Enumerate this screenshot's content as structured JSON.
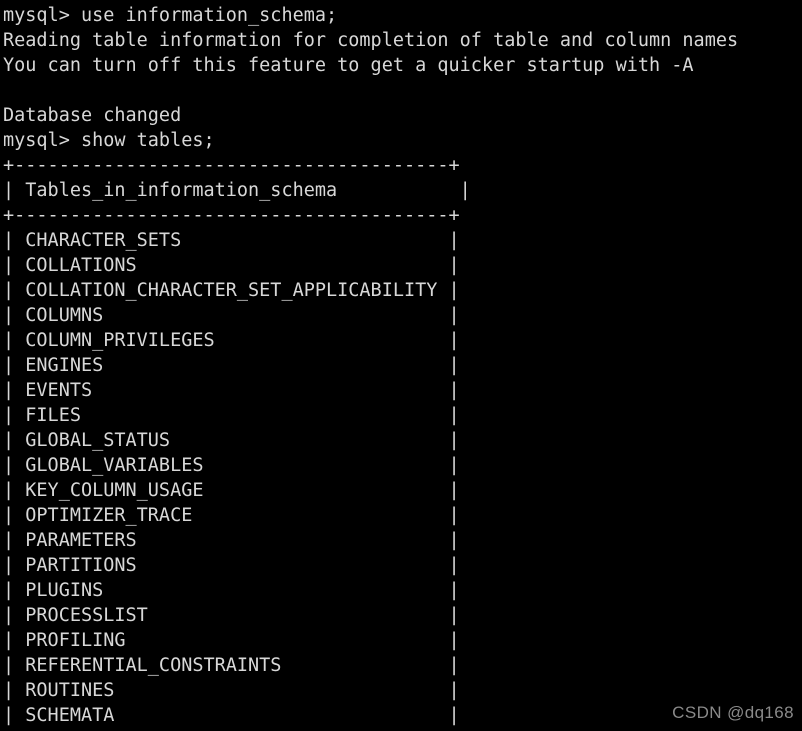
{
  "terminal": {
    "background_color": "#000000",
    "text_color": "#d8d8d8",
    "prompt": "mysql>",
    "lines": [
      "mysql> use information_schema;",
      "Reading table information for completion of table and column names",
      "You can turn off this feature to get a quicker startup with -A",
      "",
      "Database changed",
      "mysql> show tables;",
      "+---------------------------------------+",
      "| Tables_in_information_schema           |",
      "+---------------------------------------+",
      "| CHARACTER_SETS                        |",
      "| COLLATIONS                            |",
      "| COLLATION_CHARACTER_SET_APPLICABILITY |",
      "| COLUMNS                               |",
      "| COLUMN_PRIVILEGES                     |",
      "| ENGINES                               |",
      "| EVENTS                                |",
      "| FILES                                 |",
      "| GLOBAL_STATUS                         |",
      "| GLOBAL_VARIABLES                      |",
      "| KEY_COLUMN_USAGE                      |",
      "| OPTIMIZER_TRACE                       |",
      "| PARAMETERS                            |",
      "| PARTITIONS                            |",
      "| PLUGINS                               |",
      "| PROCESSLIST                           |",
      "| PROFILING                             |",
      "| REFERENTIAL_CONSTRAINTS               |",
      "| ROUTINES                              |",
      "| SCHEMATA                              |"
    ],
    "commands": [
      "use information_schema;",
      "show tables;"
    ],
    "messages": [
      "Reading table information for completion of table and column names",
      "You can turn off this feature to get a quicker startup with -A",
      "Database changed"
    ],
    "result_table": {
      "column_header": "Tables_in_information_schema",
      "border": "+---------------------------------------+",
      "rows": [
        "CHARACTER_SETS",
        "COLLATIONS",
        "COLLATION_CHARACTER_SET_APPLICABILITY",
        "COLUMNS",
        "COLUMN_PRIVILEGES",
        "ENGINES",
        "EVENTS",
        "FILES",
        "GLOBAL_STATUS",
        "GLOBAL_VARIABLES",
        "KEY_COLUMN_USAGE",
        "OPTIMIZER_TRACE",
        "PARAMETERS",
        "PARTITIONS",
        "PLUGINS",
        "PROCESSLIST",
        "PROFILING",
        "REFERENTIAL_CONSTRAINTS",
        "ROUTINES",
        "SCHEMATA"
      ]
    }
  },
  "watermark": {
    "text": "CSDN @dq168",
    "color": "#8a8a8a"
  }
}
